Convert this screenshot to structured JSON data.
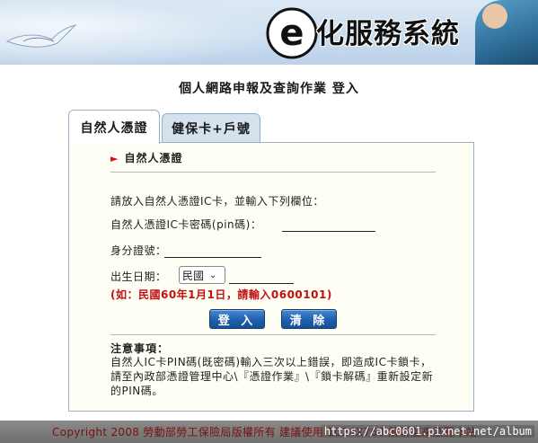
{
  "banner": {
    "title": "化服務系統",
    "logo_letter": "e"
  },
  "page_heading": "個人網路申報及查詢作業 登入",
  "tabs": [
    {
      "label": "自然人憑證",
      "active": true
    },
    {
      "label": "健保卡+戶號",
      "active": false
    }
  ],
  "section": {
    "arrow": "►",
    "title": "自然人憑證"
  },
  "form": {
    "instruction": "請放入自然人憑證IC卡，並輸入下列欄位：",
    "pin_label": "自然人憑證IC卡密碼(pin碼)：",
    "id_label": "身分證號：",
    "birth_label": "出生日期：",
    "era_selected": "民國",
    "example": "(如：民國60年1月1日，請輸入0600101)"
  },
  "buttons": {
    "login": "登 入",
    "clear": "清 除"
  },
  "notes": {
    "title": "注意事項：",
    "text": "自然人IC卡PIN碼(既密碼)輸入三次以上錯誤，即造成IC卡鎖卡，請至內政部憑證管理中心\\『憑證作業』\\『鎖卡解碼』重新設定新的PIN碼。"
  },
  "footer": {
    "copyright": "Copyright 2008 勞動部勞工保險局版權所有 建議使用 1024X768 解析度來瀏覽本站",
    "watermark": "https://abc0601.pixnet.net/album"
  },
  "colors": {
    "accent_red": "#c01010",
    "button_blue": "#1e5fae",
    "tab_inactive": "#d5e2ee"
  }
}
